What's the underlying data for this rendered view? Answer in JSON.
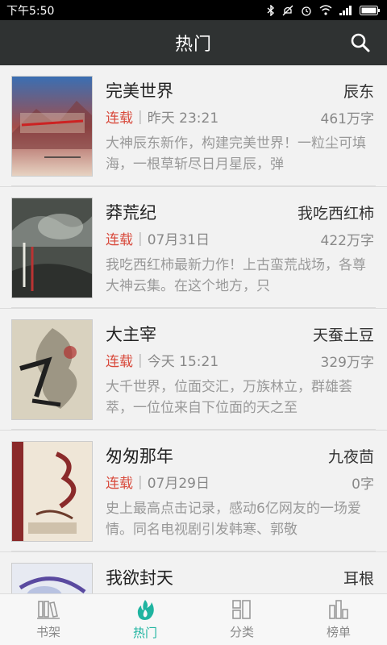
{
  "status_bar": {
    "time": "下午5:50",
    "icons": [
      "bluetooth-icon",
      "mute-icon",
      "alarm-icon",
      "wifi-icon",
      "signal-icon",
      "battery-icon"
    ]
  },
  "header": {
    "title": "热门",
    "search_icon": "search-icon"
  },
  "books": [
    {
      "title": "完美世界",
      "author": "辰东",
      "status": "连载",
      "updated": "昨天 23:21",
      "words": "461万字",
      "description": "大神辰东新作，构建完美世界！一粒尘可填海，一根草斩尽日月星辰，弹"
    },
    {
      "title": "莽荒纪",
      "author": "我吃西红柿",
      "status": "连载",
      "updated": "07月31日",
      "words": "422万字",
      "description": "我吃西红柿最新力作！上古蛮荒战场，各尊大神云集。在这个地方，只"
    },
    {
      "title": "大主宰",
      "author": "天蚕土豆",
      "status": "连载",
      "updated": "今天 15:21",
      "words": "329万字",
      "description": "大千世界，位面交汇，万族林立，群雄荟萃，一位位来自下位面的天之至"
    },
    {
      "title": "匆匆那年",
      "author": "九夜茴",
      "status": "连载",
      "updated": "07月29日",
      "words": "0字",
      "description": "史上最高点击记录，感动6亿网友的一场爱情。同名电视剧引发韩寒、郭敬"
    },
    {
      "title": "我欲封天",
      "author": "耳根",
      "status": "",
      "updated": "",
      "words": "",
      "description": ""
    }
  ],
  "nav": [
    {
      "label": "书架",
      "icon": "bookshelf-icon",
      "active": false
    },
    {
      "label": "热门",
      "icon": "flame-icon",
      "active": true
    },
    {
      "label": "分类",
      "icon": "category-icon",
      "active": false
    },
    {
      "label": "榜单",
      "icon": "chart-icon",
      "active": false
    }
  ],
  "colors": {
    "header_bg": "#2f3232",
    "accent": "#1fb4a0",
    "status_red": "#d84a3c"
  }
}
